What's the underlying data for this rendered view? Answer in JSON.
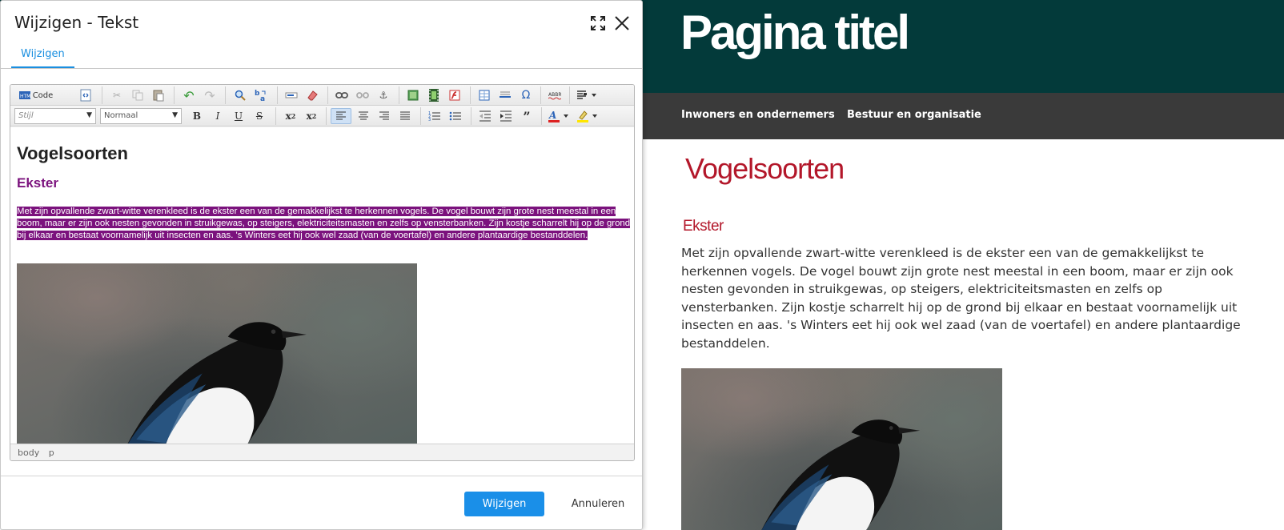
{
  "dialog": {
    "title": "Wijzigen - Tekst",
    "maximize_icon": "maximize-icon",
    "close_icon": "close-icon",
    "tab_label": "Wijzigen",
    "primary_label": "Wijzigen",
    "secondary_label": "Annuleren",
    "accent_color": "#1a8fe8"
  },
  "editor": {
    "toolbar": {
      "source_label": "Code",
      "style_placeholder": "Stijl",
      "format_value": "Normaal"
    },
    "content": {
      "heading": "Vogelsoorten",
      "subheading": "Ekster",
      "paragraph": "Met zijn opvallende zwart-witte verenkleed is de ekster een van de gemakkelijkst te herkennen vogels. De vogel bouwt zijn grote nest meestal in een boom, maar er zijn ook nesten gevonden in struikgewas, op steigers, elektriciteitsmasten en zelfs op vensterbanken. Zijn kostje scharrelt hij op de grond bij elkaar en bestaat voornamelijk uit insecten en aas. 's Winters eet hij ook wel zaad (van de voertafel) en andere plantaardige bestanddelen.",
      "highlight_color": "#7b127d"
    },
    "status_path": [
      "body",
      "p"
    ]
  },
  "site": {
    "page_title": "Pagina titel",
    "nav": [
      "Inwoners en ondernemers",
      "Bestuur en organisatie"
    ],
    "heading": "Vogelsoorten",
    "subheading": "Ekster",
    "paragraph": "Met zijn opvallende zwart-witte verenkleed is de ekster een van de gemakkelijkst te herkennen vogels. De vogel bouwt zijn grote nest meestal in een boom, maar er zijn ook nesten gevonden in struikgewas, op steigers, elektriciteitsmasten en zelfs op vensterbanken. Zijn kostje scharrelt hij op de grond bij elkaar en bestaat voornamelijk uit insecten en aas. 's Winters eet hij ook wel zaad (van de voertafel) en andere plantaardige bestanddelen.",
    "header_color": "#033a3a",
    "nav_color": "#3a3a3a",
    "heading_color": "#b3172a"
  }
}
